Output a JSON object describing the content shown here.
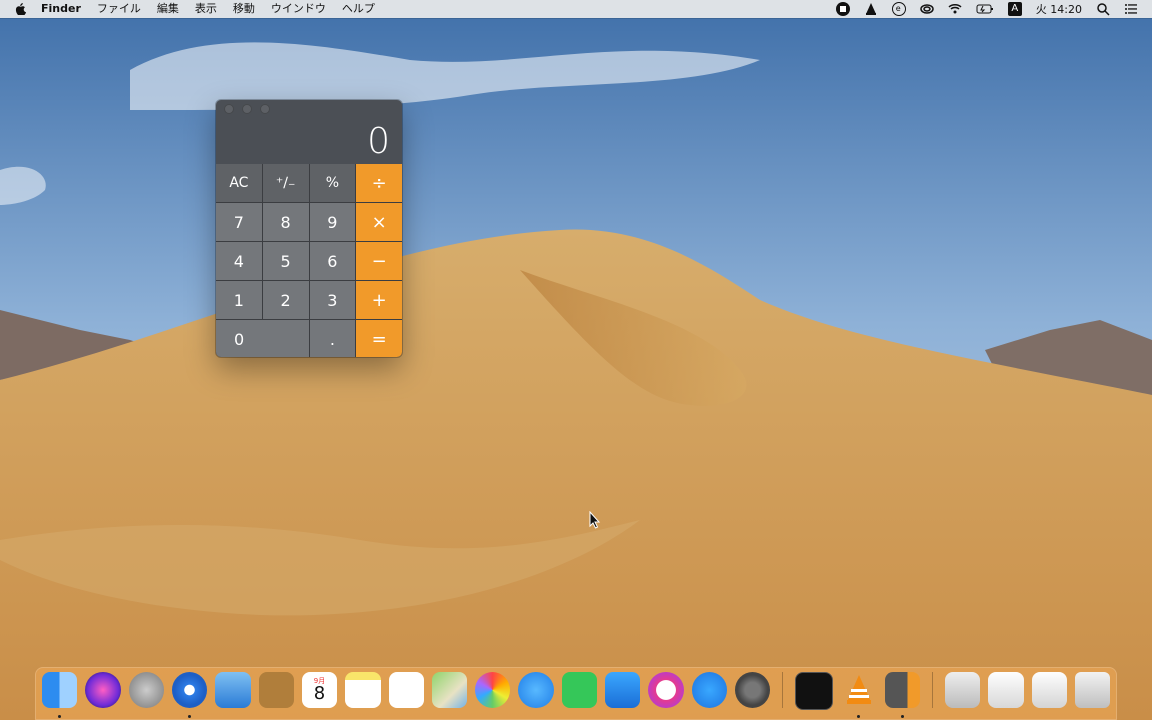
{
  "menubar": {
    "app_name": "Finder",
    "menus": [
      "ファイル",
      "編集",
      "表示",
      "移動",
      "ウインドウ",
      "ヘルプ"
    ],
    "clock": "火 14:20",
    "input_mode": "A"
  },
  "calculator": {
    "display": "0",
    "keys": {
      "ac": "AC",
      "sign": "⁺∕₋",
      "percent": "%",
      "divide": "÷",
      "seven": "7",
      "eight": "8",
      "nine": "9",
      "multiply": "×",
      "four": "4",
      "five": "5",
      "six": "6",
      "minus": "−",
      "one": "1",
      "two": "2",
      "three": "3",
      "plus": "+",
      "zero": "0",
      "dot": ".",
      "equals": "="
    }
  },
  "dock": {
    "calendar_month": "9月",
    "calendar_day": "8",
    "icons": [
      "finder-icon",
      "siri-icon",
      "launchpad-icon",
      "safari-icon",
      "mail-icon",
      "contacts-icon",
      "calendar-icon",
      "notes-icon",
      "reminders-icon",
      "maps-icon",
      "photos-icon",
      "messages-icon",
      "facetime-icon",
      "keynote-icon",
      "itunes-icon",
      "app-store-icon",
      "system-preferences-icon",
      "activity-monitor-icon",
      "vlc-icon",
      "calculator-icon",
      "stack-documents-icon",
      "stack-screenshots-icon",
      "stack-downloads-icon",
      "trash-icon"
    ]
  },
  "colors": {
    "calc_orange": "#f19a2a",
    "calc_key": "#74777b",
    "calc_fn": "#5f6266"
  }
}
